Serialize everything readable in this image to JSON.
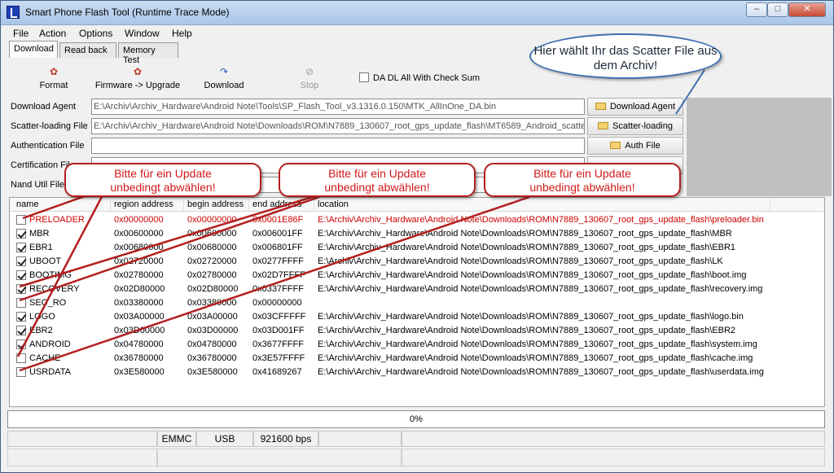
{
  "window": {
    "title": "Smart Phone Flash Tool (Runtime Trace Mode)",
    "controls": {
      "minimize": "–",
      "maximize": "□",
      "close": "✕"
    }
  },
  "menu": [
    "File",
    "Action",
    "Options",
    "Window",
    "Help"
  ],
  "tabs": [
    "Download",
    "Read back",
    "Memory Test"
  ],
  "toolbar": {
    "format": "Format",
    "firmware_upgrade": "Firmware -> Upgrade",
    "download": "Download",
    "stop": "Stop",
    "da_checksum": "DA DL All With Check Sum"
  },
  "fields": {
    "download_agent": {
      "label": "Download Agent",
      "value": "E:\\Archiv\\Archiv_Hardware\\Android Note\\Tools\\SP_Flash_Tool_v3.1316.0.150\\MTK_AllInOne_DA.bin",
      "button": "Download Agent"
    },
    "scatter": {
      "label": "Scatter-loading File",
      "value": "E:\\Archiv\\Archiv_Hardware\\Android Note\\Downloads\\ROM\\N7889_130607_root_gps_update_flash\\MT6589_Android_scatte",
      "button": "Scatter-loading"
    },
    "auth": {
      "label": "Authentication File",
      "value": "",
      "button": "Auth File"
    },
    "cert": {
      "label": "Certification File",
      "value": ""
    },
    "nand": {
      "label": "Nand Util File",
      "value": ""
    }
  },
  "table": {
    "headers": [
      "name",
      "region address",
      "begin address",
      "end address",
      "location"
    ],
    "rows": [
      {
        "name": "PRELOADER",
        "checked": false,
        "region": "0x00000000",
        "begin": "0x00000000",
        "end": "0x0001E86F",
        "location": "E:\\Archiv\\Archiv_Hardware\\Android Note\\Downloads\\ROM\\N7889_130607_root_gps_update_flash\\preloader.bin"
      },
      {
        "name": "MBR",
        "checked": true,
        "region": "0x00600000",
        "begin": "0x00600000",
        "end": "0x006001FF",
        "location": "E:\\Archiv\\Archiv_Hardware\\Android Note\\Downloads\\ROM\\N7889_130607_root_gps_update_flash\\MBR"
      },
      {
        "name": "EBR1",
        "checked": true,
        "region": "0x00680000",
        "begin": "0x00680000",
        "end": "0x006801FF",
        "location": "E:\\Archiv\\Archiv_Hardware\\Android Note\\Downloads\\ROM\\N7889_130607_root_gps_update_flash\\EBR1"
      },
      {
        "name": "UBOOT",
        "checked": true,
        "region": "0x02720000",
        "begin": "0x02720000",
        "end": "0x0277FFFF",
        "location": "E:\\Archiv\\Archiv_Hardware\\Android Note\\Downloads\\ROM\\N7889_130607_root_gps_update_flash\\LK"
      },
      {
        "name": "BOOTIMG",
        "checked": true,
        "region": "0x02780000",
        "begin": "0x02780000",
        "end": "0x02D7FFFF",
        "location": "E:\\Archiv\\Archiv_Hardware\\Android Note\\Downloads\\ROM\\N7889_130607_root_gps_update_flash\\boot.img"
      },
      {
        "name": "RECOVERY",
        "checked": true,
        "region": "0x02D80000",
        "begin": "0x02D80000",
        "end": "0x0337FFFF",
        "location": "E:\\Archiv\\Archiv_Hardware\\Android Note\\Downloads\\ROM\\N7889_130607_root_gps_update_flash\\recovery.img"
      },
      {
        "name": "SEC_RO",
        "checked": false,
        "region": "0x03380000",
        "begin": "0x03380000",
        "end": "0x00000000",
        "location": ""
      },
      {
        "name": "LOGO",
        "checked": true,
        "region": "0x03A00000",
        "begin": "0x03A00000",
        "end": "0x03CFFFFF",
        "location": "E:\\Archiv\\Archiv_Hardware\\Android Note\\Downloads\\ROM\\N7889_130607_root_gps_update_flash\\logo.bin"
      },
      {
        "name": "EBR2",
        "checked": true,
        "region": "0x03D00000",
        "begin": "0x03D00000",
        "end": "0x03D001FF",
        "location": "E:\\Archiv\\Archiv_Hardware\\Android Note\\Downloads\\ROM\\N7889_130607_root_gps_update_flash\\EBR2"
      },
      {
        "name": "ANDROID",
        "checked": true,
        "region": "0x04780000",
        "begin": "0x04780000",
        "end": "0x3677FFFF",
        "location": "E:\\Archiv\\Archiv_Hardware\\Android Note\\Downloads\\ROM\\N7889_130607_root_gps_update_flash\\system.img"
      },
      {
        "name": "CACHE",
        "checked": false,
        "region": "0x36780000",
        "begin": "0x36780000",
        "end": "0x3E57FFFF",
        "location": "E:\\Archiv\\Archiv_Hardware\\Android Note\\Downloads\\ROM\\N7889_130607_root_gps_update_flash\\cache.img"
      },
      {
        "name": "USRDATA",
        "checked": false,
        "region": "0x3E580000",
        "begin": "0x3E580000",
        "end": "0x41689267",
        "location": "E:\\Archiv\\Archiv_Hardware\\Android Note\\Downloads\\ROM\\N7889_130607_root_gps_update_flash\\userdata.img"
      }
    ]
  },
  "progress": {
    "text": "0%",
    "value": 0
  },
  "status": {
    "storage": "EMMC",
    "port": "USB",
    "baud": "921600 bps"
  },
  "annotations": {
    "scatter_hint": "Hier wählt Ihr das Scatter File aus dem Archiv!",
    "deselect_line1": "Bitte für ein Update",
    "deselect_line2": "unbedingt abwählen!"
  },
  "colors": {
    "warning_red": "#d00000",
    "callout_blue": "#3e6fb0"
  }
}
